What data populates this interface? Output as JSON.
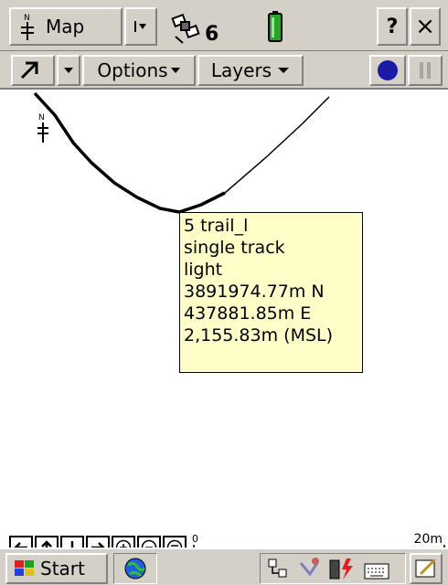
{
  "title_bar": {
    "map_label": "Map",
    "satellite_count": "6",
    "help_label": "?",
    "close_label": "×"
  },
  "toolbar": {
    "options_label": "Options",
    "layers_label": "Layers"
  },
  "feature_popup": {
    "lines": [
      "5 trail_l",
      "single track",
      "light",
      "3891974.77m N",
      "437881.85m E",
      "2,155.83m (MSL)"
    ]
  },
  "nav_bar": {
    "scale_zero": "0",
    "scale_label": "20m"
  },
  "taskbar": {
    "start_label": "Start"
  },
  "colors": {
    "chrome": "#d4d0c8",
    "popup_bg": "#fffec8",
    "record_button": "#1a1aa6",
    "battery": "#2aa12a"
  },
  "icons": [
    "north-arrow-icon",
    "dropdown-icon",
    "satellite-icon",
    "battery-icon",
    "help-icon",
    "close-icon",
    "pointer-arrow-icon",
    "record-icon",
    "pause-icon",
    "arrow-left-icon",
    "arrow-up-icon",
    "arrow-down-icon",
    "arrow-right-icon",
    "zoom-in-icon",
    "zoom-out-icon",
    "zoom-extent-icon",
    "windows-flag-icon",
    "app-globe-icon",
    "network-icon",
    "sync-icon",
    "power-icon",
    "keyboard-icon",
    "pen-icon"
  ]
}
